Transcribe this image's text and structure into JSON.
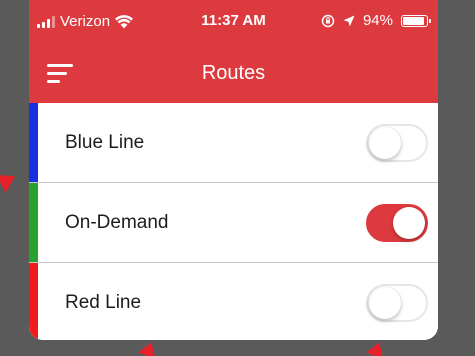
{
  "status_bar": {
    "carrier": "Verizon",
    "time": "11:37 AM",
    "battery_percent": "94%",
    "battery_level": 0.94,
    "icons": [
      "signal-icon",
      "wifi-icon",
      "orientation-lock-icon",
      "location-arrow-icon",
      "battery-icon"
    ]
  },
  "nav": {
    "title": "Routes",
    "menu_icon": "hamburger-menu-icon"
  },
  "colors": {
    "bar": "#dd3a3f",
    "annotation": "#e8202a"
  },
  "routes": [
    {
      "label": "Blue Line",
      "color": "#1a2fe0",
      "enabled": false
    },
    {
      "label": "On-Demand",
      "color": "#27a22d",
      "enabled": true
    },
    {
      "label": "Red Line",
      "color": "#f21b1b",
      "enabled": false
    }
  ]
}
